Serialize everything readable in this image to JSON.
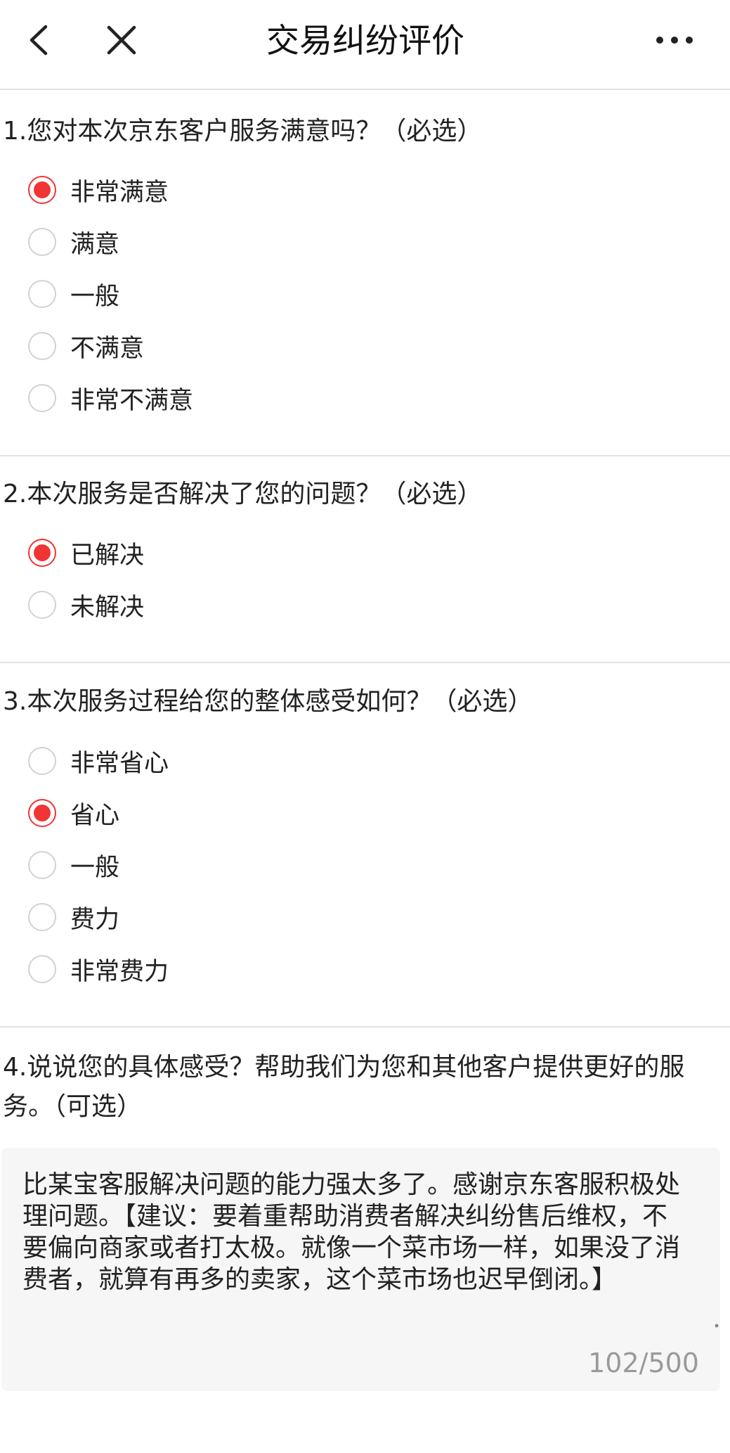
{
  "header": {
    "title": "交易纠纷评价",
    "back_icon": "chevron-left-icon",
    "close_icon": "close-icon",
    "more_icon": "more-horizontal-icon"
  },
  "accent_color": "#f03535",
  "questions": [
    {
      "text": "1.您对本次京东客户服务满意吗？（必选）",
      "options": [
        {
          "label": "非常满意",
          "checked": true
        },
        {
          "label": "满意",
          "checked": false
        },
        {
          "label": "一般",
          "checked": false
        },
        {
          "label": "不满意",
          "checked": false
        },
        {
          "label": "非常不满意",
          "checked": false
        }
      ]
    },
    {
      "text": "2.本次服务是否解决了您的问题？（必选）",
      "options": [
        {
          "label": "已解决",
          "checked": true
        },
        {
          "label": "未解决",
          "checked": false
        }
      ]
    },
    {
      "text": "3.本次服务过程给您的整体感受如何？（必选）",
      "options": [
        {
          "label": "非常省心",
          "checked": false
        },
        {
          "label": "省心",
          "checked": true
        },
        {
          "label": "一般",
          "checked": false
        },
        {
          "label": "费力",
          "checked": false
        },
        {
          "label": "非常费力",
          "checked": false
        }
      ]
    },
    {
      "text": "4.说说您的具体感受？帮助我们为您和其他客户提供更好的服务。（可选）"
    }
  ],
  "comment": {
    "value": "比某宝客服解决问题的能力强太多了。感谢京东客服积极处理问题。【建议：要着重帮助消费者解决纠纷售后维权，不要偏向商家或者打太极。就像一个菜市场一样，如果没了消费者，就算有再多的卖家，这个菜市场也迟早倒闭。】",
    "counter": "102/500"
  }
}
